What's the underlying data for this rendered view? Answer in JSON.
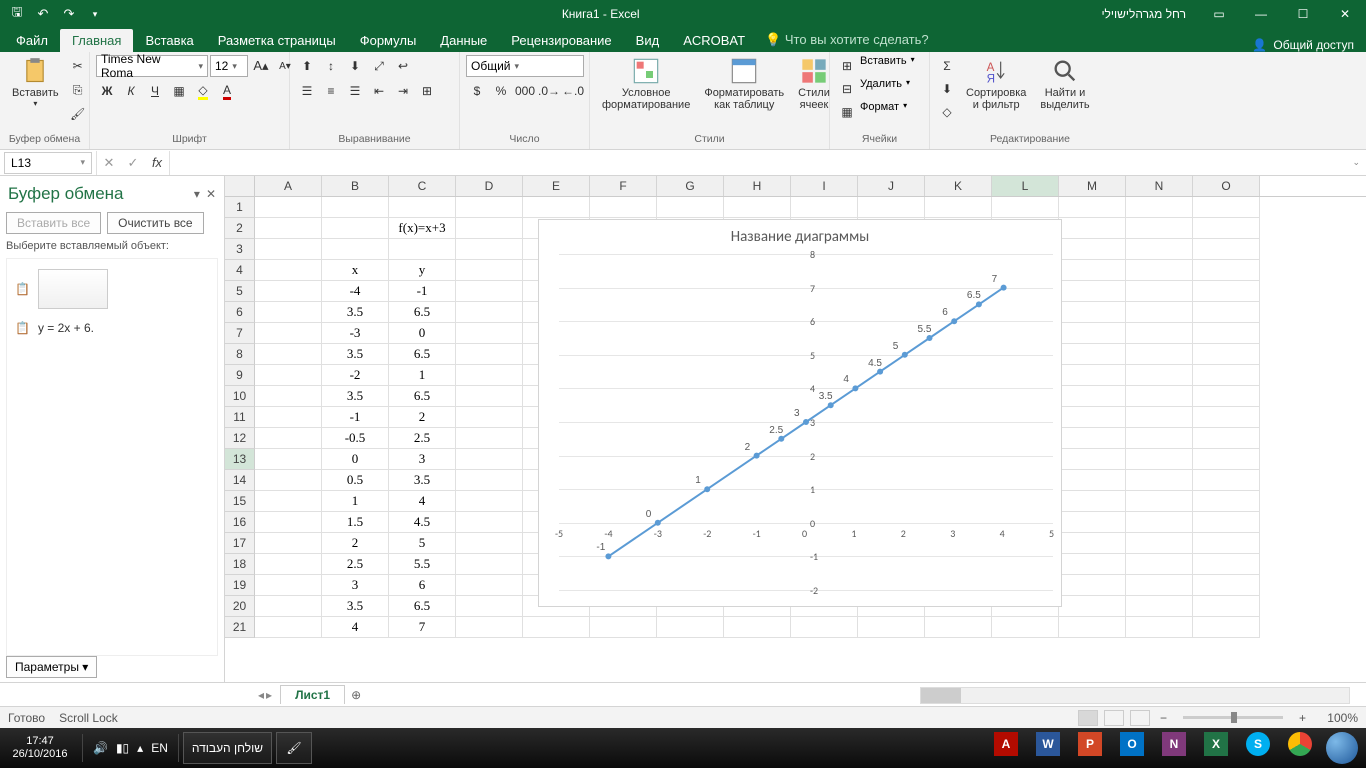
{
  "titlebar": {
    "title": "Книга1  -  Excel",
    "user": "רחל מגרהלישוילי"
  },
  "tabs": {
    "file": "Файл",
    "home": "Главная",
    "insert": "Вставка",
    "layout": "Разметка страницы",
    "formulas": "Формулы",
    "data": "Данные",
    "review": "Рецензирование",
    "view": "Вид",
    "acrobat": "ACROBAT",
    "tellme": "Что вы хотите сделать?",
    "share": "Общий доступ"
  },
  "ribbon": {
    "clipboard": {
      "title": "Буфер обмена",
      "paste": "Вставить"
    },
    "font": {
      "title": "Шрифт",
      "name": "Times New Roma",
      "size": "12",
      "bold": "Ж",
      "italic": "К",
      "underline": "Ч"
    },
    "align": {
      "title": "Выравнивание"
    },
    "number": {
      "title": "Число",
      "format": "Общий"
    },
    "styles": {
      "title": "Стили",
      "cond": "Условное\nформатирование",
      "table": "Форматировать\nкак таблицу",
      "cell": "Стили\nячеек"
    },
    "cells": {
      "title": "Ячейки",
      "insert": "Вставить",
      "delete": "Удалить",
      "format": "Формат"
    },
    "editing": {
      "title": "Редактирование",
      "sort": "Сортировка\nи фильтр",
      "find": "Найти и\nвыделить"
    }
  },
  "namebox": "L13",
  "clipboard_pane": {
    "title": "Буфер обмена",
    "paste_all": "Вставить все",
    "clear_all": "Очистить все",
    "hint": "Выберите вставляемый объект:",
    "items": [
      "",
      "y = 2x + 6."
    ],
    "params": "Параметры"
  },
  "columns": [
    "A",
    "B",
    "C",
    "D",
    "E",
    "F",
    "G",
    "H",
    "I",
    "J",
    "K",
    "L",
    "M",
    "N",
    "O"
  ],
  "selected_col_index": 11,
  "selected_row": 13,
  "rows_visible": 21,
  "formula_cell": "f(x)=x+3",
  "headers": {
    "x": "x",
    "y": "y"
  },
  "table": [
    {
      "x": "-4",
      "y": "-1"
    },
    {
      "x": "3.5",
      "y": "6.5"
    },
    {
      "x": "-3",
      "y": "0"
    },
    {
      "x": "3.5",
      "y": "6.5"
    },
    {
      "x": "-2",
      "y": "1"
    },
    {
      "x": "3.5",
      "y": "6.5"
    },
    {
      "x": "-1",
      "y": "2"
    },
    {
      "x": "-0.5",
      "y": "2.5"
    },
    {
      "x": "0",
      "y": "3"
    },
    {
      "x": "0.5",
      "y": "3.5"
    },
    {
      "x": "1",
      "y": "4"
    },
    {
      "x": "1.5",
      "y": "4.5"
    },
    {
      "x": "2",
      "y": "5"
    },
    {
      "x": "2.5",
      "y": "5.5"
    },
    {
      "x": "3",
      "y": "6"
    },
    {
      "x": "3.5",
      "y": "6.5"
    },
    {
      "x": "4",
      "y": "7"
    }
  ],
  "chart_data": {
    "type": "line",
    "title": "Название диаграммы",
    "xlabel": "",
    "ylabel": "",
    "xlim": [
      -5,
      5
    ],
    "ylim": [
      -2,
      8
    ],
    "x_ticks": [
      -5,
      -4,
      -3,
      -2,
      -1,
      0,
      1,
      2,
      3,
      4,
      5
    ],
    "y_ticks": [
      -2,
      -1,
      0,
      1,
      2,
      3,
      4,
      5,
      6,
      7,
      8
    ],
    "series": [
      {
        "name": "y",
        "x": [
          -4,
          -3,
          -2,
          -1,
          -0.5,
          0,
          0.5,
          1,
          1.5,
          2,
          2.5,
          3,
          3.5,
          4
        ],
        "y": [
          -1,
          0,
          1,
          2,
          2.5,
          3,
          3.5,
          4,
          4.5,
          5,
          5.5,
          6,
          6.5,
          7
        ],
        "labels": [
          "-1",
          "0",
          "1",
          "2",
          "2.5",
          "3",
          "3.5",
          "4",
          "4.5",
          "5",
          "5.5",
          "6",
          "6.5",
          "7"
        ]
      }
    ]
  },
  "sheet_tabs": {
    "active": "Лист1"
  },
  "status": {
    "ready": "Готово",
    "scroll": "Scroll Lock",
    "zoom": "100%"
  },
  "taskbar": {
    "time": "17:47",
    "date": "26/10/2016",
    "lang": "EN",
    "task": "שולחן העבודה"
  }
}
